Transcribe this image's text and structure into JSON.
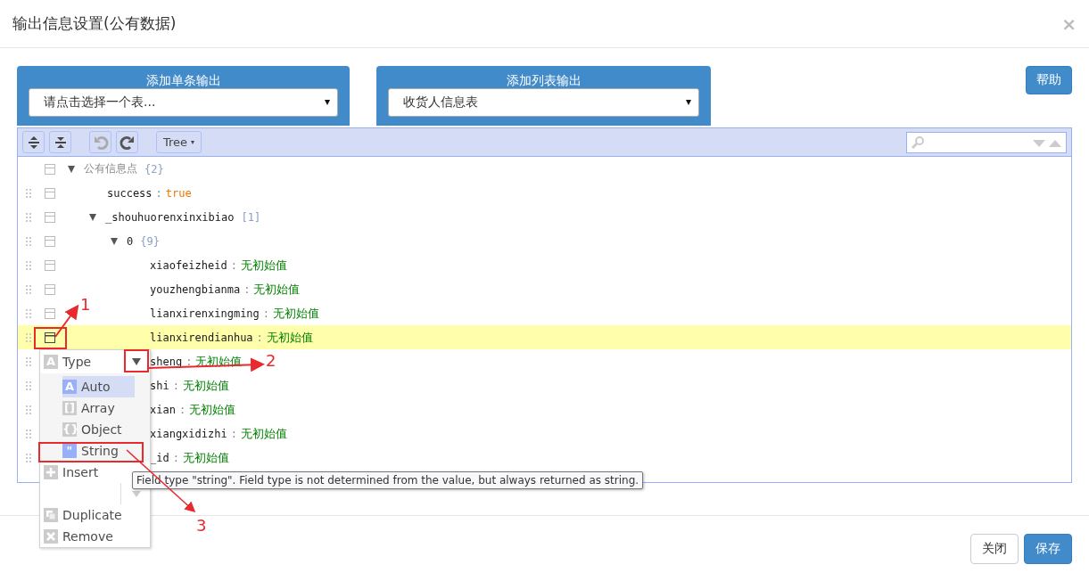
{
  "dialog": {
    "title": "输出信息设置(公有数据)",
    "close": "×"
  },
  "single_output": {
    "title": "添加单条输出",
    "select": "请点击选择一个表..."
  },
  "list_output": {
    "title": "添加列表输出",
    "select": "收货人信息表"
  },
  "help_button": "帮助",
  "editor": {
    "mode": "Tree",
    "separator": ":"
  },
  "tree": [
    {
      "key": "公有信息点",
      "count": "{2}",
      "expanded": true,
      "selected": false,
      "children": [
        {
          "key": "success",
          "value": "true",
          "kind": "boolean",
          "selected": false
        },
        {
          "key": "_shouhuorenxinxibiao",
          "count": "[1]",
          "expanded": true,
          "selected": false,
          "children": [
            {
              "key": "0",
              "count": "{9}",
              "expanded": true,
              "selected": false,
              "children": [
                {
                  "key": "xiaofeizheid",
                  "value": "无初始值",
                  "kind": "string",
                  "selected": false
                },
                {
                  "key": "youzhengbianma",
                  "value": "无初始值",
                  "kind": "string",
                  "selected": false
                },
                {
                  "key": "lianxirenxingming",
                  "value": "无初始值",
                  "kind": "string",
                  "selected": false
                },
                {
                  "key": "lianxirendianhua",
                  "value": "无初始值",
                  "kind": "string",
                  "selected": true
                },
                {
                  "key": "sheng",
                  "value": "无初始值",
                  "kind": "string",
                  "selected": false
                },
                {
                  "key": "shi",
                  "value": "无初始值",
                  "kind": "string",
                  "selected": false
                },
                {
                  "key": "xian",
                  "value": "无初始值",
                  "kind": "string",
                  "selected": false
                },
                {
                  "key": "xiangxidizhi",
                  "value": "无初始值",
                  "kind": "string",
                  "selected": false
                },
                {
                  "key": "_id",
                  "value": "无初始值",
                  "kind": "string",
                  "selected": false
                }
              ]
            }
          ]
        }
      ]
    }
  ],
  "context_menu": {
    "items": [
      {
        "kind": "submenu",
        "label": "Type",
        "icon": "A",
        "expanded": true,
        "children": [
          {
            "label": "Auto",
            "icon": "A",
            "selected": true
          },
          {
            "label": "Array",
            "icon": "[]",
            "selected": false
          },
          {
            "label": "Object",
            "icon": "{}",
            "selected": false
          },
          {
            "label": "String",
            "icon": "\"",
            "selected": false
          }
        ]
      },
      {
        "kind": "split",
        "label": "Insert"
      },
      {
        "kind": "duplicate",
        "label": "Duplicate"
      },
      {
        "kind": "remove",
        "label": "Remove"
      }
    ]
  },
  "tooltip": "Field type \"string\". Field type is not determined from the value, but always returned as string.",
  "annotations": [
    "1",
    "2",
    "3"
  ],
  "footer_buttons": [
    {
      "label": "关闭",
      "kind": "default"
    },
    {
      "label": "保存",
      "kind": "primary"
    }
  ]
}
